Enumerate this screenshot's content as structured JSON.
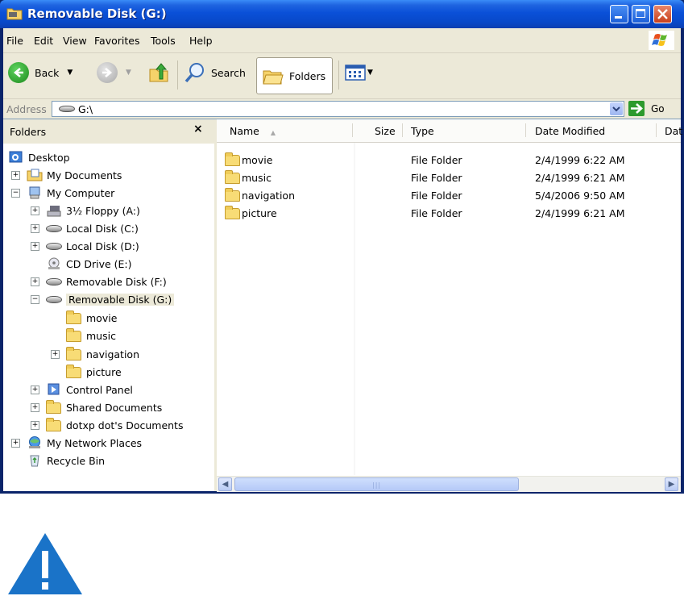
{
  "window": {
    "title": "Removable Disk (G:)"
  },
  "menubar": {
    "items": [
      "File",
      "Edit",
      "View",
      "Favorites",
      "Tools",
      "Help"
    ]
  },
  "toolbar": {
    "back_label": "Back",
    "search_label": "Search",
    "folders_label": "Folders"
  },
  "address": {
    "label": "Address",
    "value": "G:\\",
    "go_label": "Go"
  },
  "folders_pane": {
    "title": "Folders",
    "close_glyph": "×",
    "tree": [
      {
        "label": "Desktop",
        "icon": "desktop-icon"
      },
      {
        "label": "My Documents",
        "icon": "my-documents-icon"
      },
      {
        "label": "My Computer",
        "icon": "my-computer-icon"
      },
      {
        "label": "3½ Floppy (A:)",
        "icon": "floppy-icon"
      },
      {
        "label": "Local Disk (C:)",
        "icon": "local-disk-icon"
      },
      {
        "label": "Local Disk (D:)",
        "icon": "local-disk-icon"
      },
      {
        "label": "CD Drive (E:)",
        "icon": "cd-drive-icon"
      },
      {
        "label": "Removable Disk (F:)",
        "icon": "removable-disk-icon"
      },
      {
        "label": "Removable Disk (G:)",
        "icon": "removable-disk-icon"
      },
      {
        "label": "movie",
        "icon": "folder-icon"
      },
      {
        "label": "music",
        "icon": "folder-icon"
      },
      {
        "label": "navigation",
        "icon": "folder-icon"
      },
      {
        "label": "picture",
        "icon": "folder-icon"
      },
      {
        "label": "Control Panel",
        "icon": "control-panel-icon"
      },
      {
        "label": "Shared Documents",
        "icon": "folder-icon"
      },
      {
        "label": "dotxp dot's Documents",
        "icon": "folder-icon"
      },
      {
        "label": "My Network Places",
        "icon": "network-icon"
      },
      {
        "label": "Recycle Bin",
        "icon": "recycle-bin-icon"
      }
    ]
  },
  "file_list": {
    "columns": [
      "Name",
      "Size",
      "Type",
      "Date Modified",
      "Dat"
    ],
    "rows": [
      {
        "name": "movie",
        "size": "",
        "type": "File Folder",
        "date": "2/4/1999 6:22 AM"
      },
      {
        "name": "music",
        "size": "",
        "type": "File Folder",
        "date": "2/4/1999 6:21 AM"
      },
      {
        "name": "navigation",
        "size": "",
        "type": "File Folder",
        "date": "5/4/2006 9:50 AM"
      },
      {
        "name": "picture",
        "size": "",
        "type": "File Folder",
        "date": "2/4/1999 6:21 AM"
      }
    ]
  },
  "colors": {
    "titlebar": "#0a50d8",
    "chrome": "#ece9d8",
    "warning": "#1a73c8"
  }
}
